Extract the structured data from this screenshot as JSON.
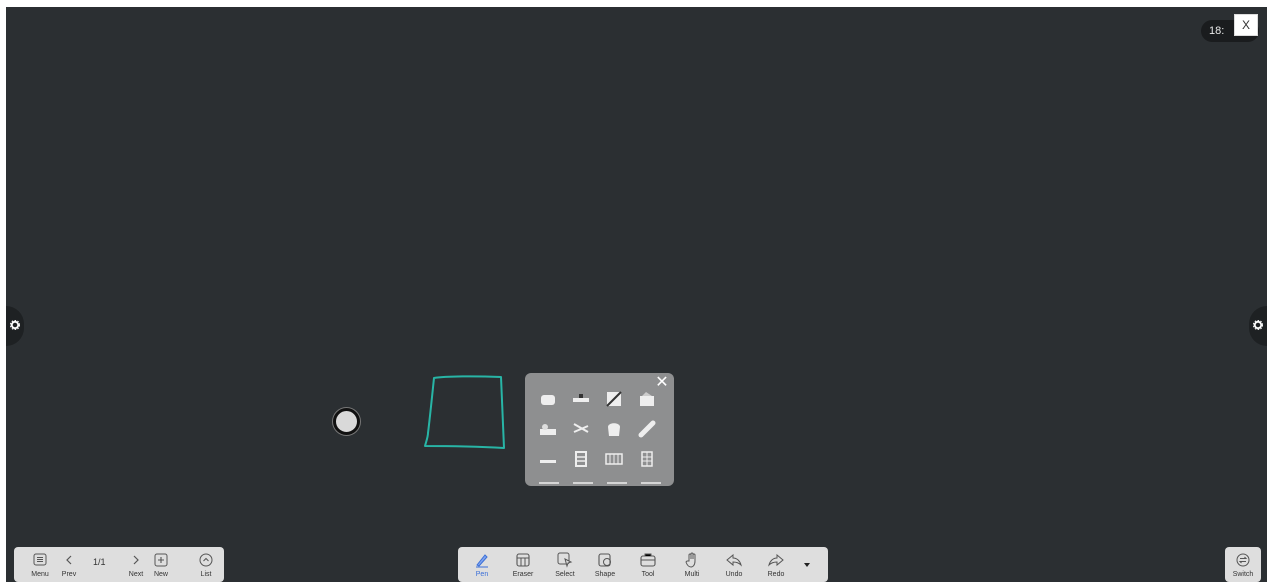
{
  "clock": {
    "text": "18:"
  },
  "close_button": {
    "label": "X"
  },
  "side_tabs": {
    "left_icon": "gear-icon",
    "right_icon": "gear-icon"
  },
  "stroke": {
    "color": "#28b5a6"
  },
  "shape_panel": {
    "close_icon": "close-icon",
    "items": [
      "bread-slice-icon",
      "baguette-icon",
      "cheese-icon",
      "cake-icon",
      "bakery-tray-icon",
      "scissors-icon",
      "toast-icon",
      "loaf-icon",
      "ruler-icon",
      "ladder-icon",
      "grid-wide-icon",
      "grid-narrow-icon"
    ]
  },
  "left_toolbar": {
    "menu_label": "Menu",
    "prev_label": "Prev",
    "page_counter": "1/1",
    "next_label": "Next",
    "new_label": "New",
    "list_label": "List"
  },
  "center_toolbar": {
    "active": "Pen",
    "active_color": "#3a6fd8",
    "items": [
      {
        "label": "Pen",
        "icon": "pen-icon"
      },
      {
        "label": "Eraser",
        "icon": "eraser-icon"
      },
      {
        "label": "Select",
        "icon": "select-icon"
      },
      {
        "label": "Shape",
        "icon": "shape-icon"
      },
      {
        "label": "Tool",
        "icon": "toolbox-icon"
      },
      {
        "label": "Multi",
        "icon": "hand-icon"
      },
      {
        "label": "Undo",
        "icon": "undo-icon"
      },
      {
        "label": "Redo",
        "icon": "redo-icon"
      }
    ],
    "more_icon": "caret-down-icon"
  },
  "right_toolbar": {
    "switch_label": "Switch"
  }
}
